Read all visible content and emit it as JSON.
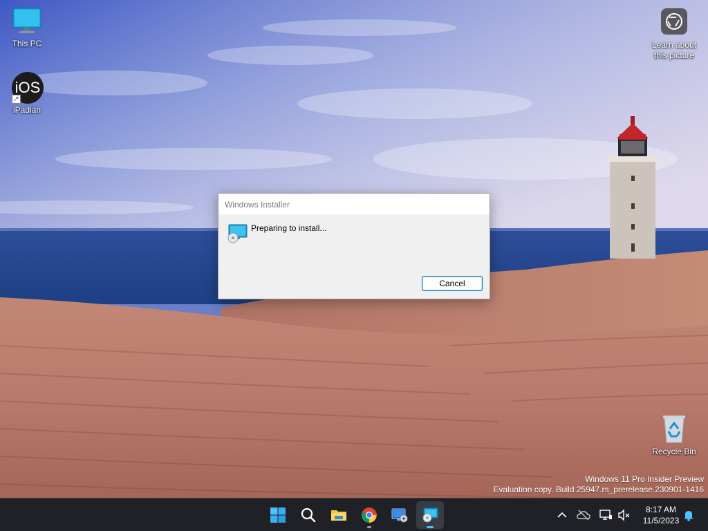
{
  "desktop": {
    "icons": [
      {
        "label": "This PC",
        "icon": "monitor-icon"
      },
      {
        "label": "iPadian",
        "icon": "ios-app-icon",
        "glyph_text": "iOS"
      },
      {
        "label": "Recycle Bin",
        "icon": "recycle-bin-icon"
      }
    ],
    "learn_about": {
      "label_line1": "Learn about",
      "label_line2": "this picture",
      "icon": "camera-lens-icon"
    },
    "watermark": {
      "line1": "Windows 11 Pro Insider Preview",
      "line2": "Evaluation copy. Build 25947.rs_prerelease.230901-1416"
    }
  },
  "dialog": {
    "title": "Windows Installer",
    "message": "Preparing to install...",
    "cancel_label": "Cancel",
    "icon": "installer-icon"
  },
  "taskbar": {
    "apps": [
      {
        "name": "start",
        "icon": "windows-logo-icon",
        "running": false,
        "active": false
      },
      {
        "name": "search",
        "icon": "search-icon",
        "running": false,
        "active": false
      },
      {
        "name": "file-explorer",
        "icon": "folder-icon",
        "running": false,
        "active": false
      },
      {
        "name": "chrome",
        "icon": "chrome-icon",
        "running": true,
        "active": false
      },
      {
        "name": "remote-desktop",
        "icon": "remote-desktop-icon",
        "running": false,
        "active": false
      },
      {
        "name": "windows-installer",
        "icon": "installer-icon",
        "running": true,
        "active": true
      }
    ],
    "tray": {
      "icons": [
        "chevron-up-icon",
        "cloud-offline-icon",
        "network-icon",
        "speaker-muted-icon",
        "notification-bell-icon"
      ],
      "time": "8:17 AM",
      "date": "11/5/2023"
    }
  },
  "colors": {
    "accent": "#0067c0",
    "taskbar_bg": "#1f2127",
    "active_indicator": "#4cc2ff",
    "dialog_bg": "#f0f0f0"
  }
}
